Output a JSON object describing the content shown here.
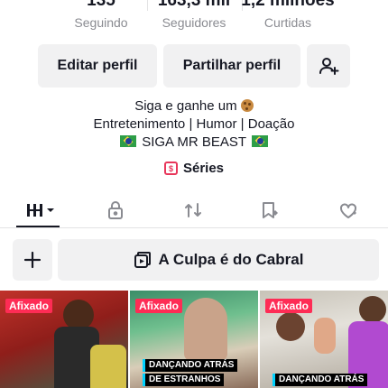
{
  "stats": [
    {
      "value": "135",
      "label": "Seguindo"
    },
    {
      "value": "163,3 mil",
      "label": "Seguidores"
    },
    {
      "value": "1,2 milhões",
      "label": "Curtidas"
    }
  ],
  "buttons": {
    "edit_profile": "Editar perfil",
    "share_profile": "Partilhar perfil",
    "add_friend_icon": "person-plus-icon"
  },
  "bio": {
    "line1": "Siga e ganhe um",
    "line2": "Entretenimento | Humor | Doação",
    "line3": "SIGA MR BEAST"
  },
  "series": {
    "label": "Séries",
    "icon": "series-icon"
  },
  "tabs": [
    {
      "name": "videos-grid",
      "icon": "grid-icon",
      "active": true
    },
    {
      "name": "private",
      "icon": "lock-icon"
    },
    {
      "name": "reposts",
      "icon": "repost-icon"
    },
    {
      "name": "favorites",
      "icon": "bookmark-icon"
    },
    {
      "name": "liked",
      "icon": "heart-icon"
    }
  ],
  "playlist": {
    "label": "A Culpa é do Cabral",
    "add_icon": "plus-icon"
  },
  "videos": [
    {
      "pinned_label": "Afixado",
      "caption": ""
    },
    {
      "pinned_label": "Afixado",
      "caption_line1": "DANÇANDO ATRÁS",
      "caption_line2": "DE ESTRANHOS"
    },
    {
      "pinned_label": "Afixado",
      "caption_line1": "DANÇANDO ATRÁS",
      "caption_line2": ""
    }
  ],
  "colors": {
    "accent": "#fe2c55",
    "series": "#e8375b",
    "caption_border": "#00d2ff"
  }
}
